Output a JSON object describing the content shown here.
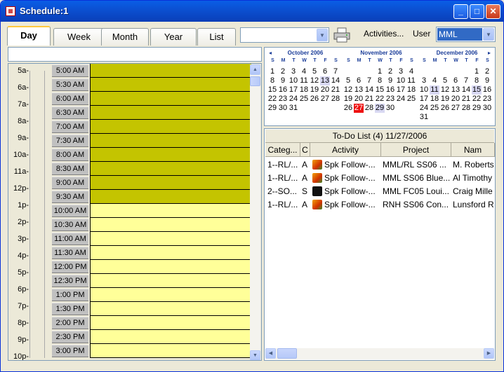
{
  "window": {
    "title": "Schedule:1",
    "app_icon": "calendar-icon"
  },
  "tabs": [
    {
      "label": "Day"
    },
    {
      "label": "Week"
    },
    {
      "label": "Month"
    },
    {
      "label": "Year"
    },
    {
      "label": "List"
    }
  ],
  "toolbar": {
    "filter_value": "",
    "activities_label": "Activities...",
    "user_label": "User",
    "user_value": "MML"
  },
  "day_view": {
    "hours": [
      "5a-",
      "6a-",
      "7a-",
      "8a-",
      "9a-",
      "10a-",
      "11a-",
      "12p-",
      "1p-",
      "2p-",
      "3p-",
      "4p-",
      "5p-",
      "6p-",
      "7p-",
      "8p-",
      "9p-",
      "10p-"
    ],
    "slots": [
      {
        "time": "5:00 AM",
        "busy": true
      },
      {
        "time": "5:30 AM",
        "busy": true
      },
      {
        "time": "6:00 AM",
        "busy": true
      },
      {
        "time": "6:30 AM",
        "busy": true
      },
      {
        "time": "7:00 AM",
        "busy": true
      },
      {
        "time": "7:30 AM",
        "busy": true
      },
      {
        "time": "8:00 AM",
        "busy": true
      },
      {
        "time": "8:30 AM",
        "busy": true
      },
      {
        "time": "9:00 AM",
        "busy": true
      },
      {
        "time": "9:30 AM",
        "busy": true
      },
      {
        "time": "10:00 AM",
        "busy": false
      },
      {
        "time": "10:30 AM",
        "busy": false
      },
      {
        "time": "11:00 AM",
        "busy": false
      },
      {
        "time": "11:30 AM",
        "busy": false
      },
      {
        "time": "12:00 PM",
        "busy": false
      },
      {
        "time": "12:30 PM",
        "busy": false
      },
      {
        "time": "1:00 PM",
        "busy": false
      },
      {
        "time": "1:30 PM",
        "busy": false
      },
      {
        "time": "2:00 PM",
        "busy": false
      },
      {
        "time": "2:30 PM",
        "busy": false
      },
      {
        "time": "3:00 PM",
        "busy": false
      }
    ],
    "colors": {
      "busy": "#c4c400",
      "free": "#ffff99"
    }
  },
  "calendar": {
    "months": [
      {
        "title": "October 2006",
        "prev": "◂",
        "next": "",
        "days": [
          [
            "1",
            "2",
            "3",
            "4",
            "5",
            "6",
            "7"
          ],
          [
            "8",
            "9",
            "10",
            "11",
            "12",
            "13",
            "14"
          ],
          [
            "15",
            "16",
            "17",
            "18",
            "19",
            "20",
            "21"
          ],
          [
            "22",
            "23",
            "24",
            "25",
            "26",
            "27",
            "28"
          ],
          [
            "29",
            "30",
            "31",
            "",
            "",
            "",
            ""
          ]
        ],
        "highlight": [
          "13"
        ],
        "today": ""
      },
      {
        "title": "November 2006",
        "prev": "",
        "next": "",
        "days": [
          [
            "",
            "",
            "",
            "1",
            "2",
            "3",
            "4"
          ],
          [
            "5",
            "6",
            "7",
            "8",
            "9",
            "10",
            "11"
          ],
          [
            "12",
            "13",
            "14",
            "15",
            "16",
            "17",
            "18"
          ],
          [
            "19",
            "20",
            "21",
            "22",
            "23",
            "24",
            "25"
          ],
          [
            "26",
            "27",
            "28",
            "29",
            "30",
            "",
            ""
          ]
        ],
        "highlight": [
          "29"
        ],
        "today": "27"
      },
      {
        "title": "December 2006",
        "prev": "",
        "next": "▸",
        "days": [
          [
            "",
            "",
            "",
            "",
            "",
            "1",
            "2"
          ],
          [
            "3",
            "4",
            "5",
            "6",
            "7",
            "8",
            "9"
          ],
          [
            "10",
            "11",
            "12",
            "13",
            "14",
            "15",
            "16"
          ],
          [
            "17",
            "18",
            "19",
            "20",
            "21",
            "22",
            "23"
          ],
          [
            "24",
            "25",
            "26",
            "27",
            "28",
            "29",
            "30"
          ],
          [
            "31",
            "",
            "",
            "",
            "",
            "",
            ""
          ]
        ],
        "highlight": [
          "11",
          "15"
        ],
        "today": ""
      }
    ],
    "weekdays": [
      "S",
      "M",
      "T",
      "W",
      "T",
      "F",
      "S"
    ]
  },
  "todo": {
    "title": "To-Do List (4) 11/27/2006",
    "columns": [
      "Categ...",
      "C",
      "Activity",
      "Project",
      "Nam"
    ],
    "rows": [
      {
        "category": "1--RL/...",
        "c": "A",
        "activity": "Spk Follow-...",
        "project": "MML/RL SS06 ...",
        "name": "M. Roberts",
        "icon": "phone-icon"
      },
      {
        "category": "1--RL/...",
        "c": "A",
        "activity": "Spk Follow-...",
        "project": "MML SS06 Blue...",
        "name": "Al Timothy",
        "icon": "phone-icon"
      },
      {
        "category": "2--SO...",
        "c": "S",
        "activity": "Spk Follow-...",
        "project": "MML FC05 Loui...",
        "name": "Craig Mille",
        "icon": "phone-dark-icon"
      },
      {
        "category": "1--RL/...",
        "c": "A",
        "activity": "Spk Follow-...",
        "project": "RNH SS06 Con...",
        "name": "Lunsford R",
        "icon": "phone-icon"
      }
    ]
  }
}
